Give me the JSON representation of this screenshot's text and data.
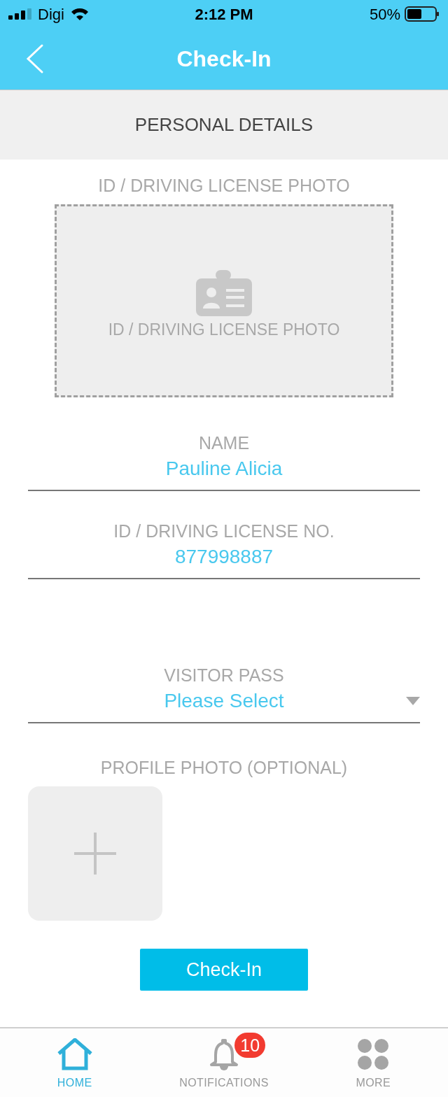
{
  "status_bar": {
    "carrier": "Digi",
    "time": "2:12 PM",
    "battery": "50%"
  },
  "header": {
    "title": "Check-In"
  },
  "section": {
    "title": "PERSONAL DETAILS"
  },
  "id_photo": {
    "label": "ID / DRIVING LICENSE PHOTO",
    "placeholder": "ID / DRIVING LICENSE PHOTO"
  },
  "fields": [
    {
      "kind": "text",
      "label": "NAME",
      "value": "Pauline Alicia"
    },
    {
      "kind": "text",
      "label": "ID / DRIVING LICENSE NO.",
      "value": "877998887"
    },
    {
      "kind": "select",
      "label": "VISITOR PASS",
      "value": "Please Select"
    }
  ],
  "profile_photo": {
    "label": "PROFILE PHOTO (OPTIONAL)"
  },
  "submit": {
    "label": "Check-In"
  },
  "tabs": [
    {
      "kind": "home",
      "label": "HOME",
      "selected": true
    },
    {
      "kind": "bell",
      "label": "NOTIFICATIONS",
      "selected": false,
      "badge": "10"
    },
    {
      "kind": "more",
      "label": "MORE",
      "selected": false
    }
  ]
}
